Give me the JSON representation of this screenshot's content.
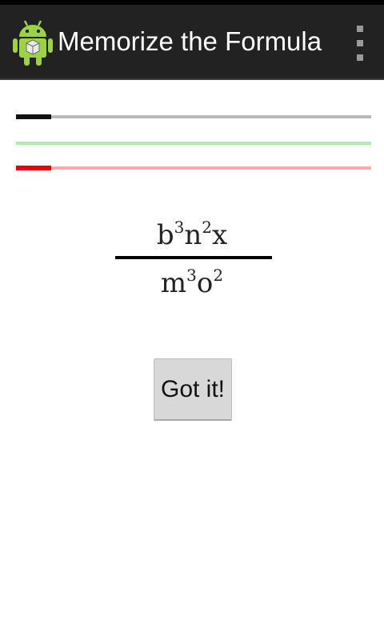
{
  "actionbar": {
    "title": "Memorize the Formula",
    "app_icon": "android-robot-icon",
    "overflow_icon": "overflow-menu-icon"
  },
  "progress": {
    "black": {
      "value": 0.1,
      "color": "#111111",
      "track_color": "#b8b8b8"
    },
    "green": {
      "value": 0.0,
      "color": "#22cc22",
      "track_color": "#aaf0aa"
    },
    "red": {
      "value": 0.1,
      "color": "#ee0000",
      "track_color": "#ffaaaa"
    }
  },
  "formula": {
    "numerator": [
      {
        "base": "b",
        "exp": "3"
      },
      {
        "base": "n",
        "exp": "2"
      },
      {
        "base": "x",
        "exp": ""
      }
    ],
    "denominator": [
      {
        "base": "m",
        "exp": "3"
      },
      {
        "base": "o",
        "exp": "2"
      }
    ]
  },
  "button": {
    "label": "Got it!"
  }
}
